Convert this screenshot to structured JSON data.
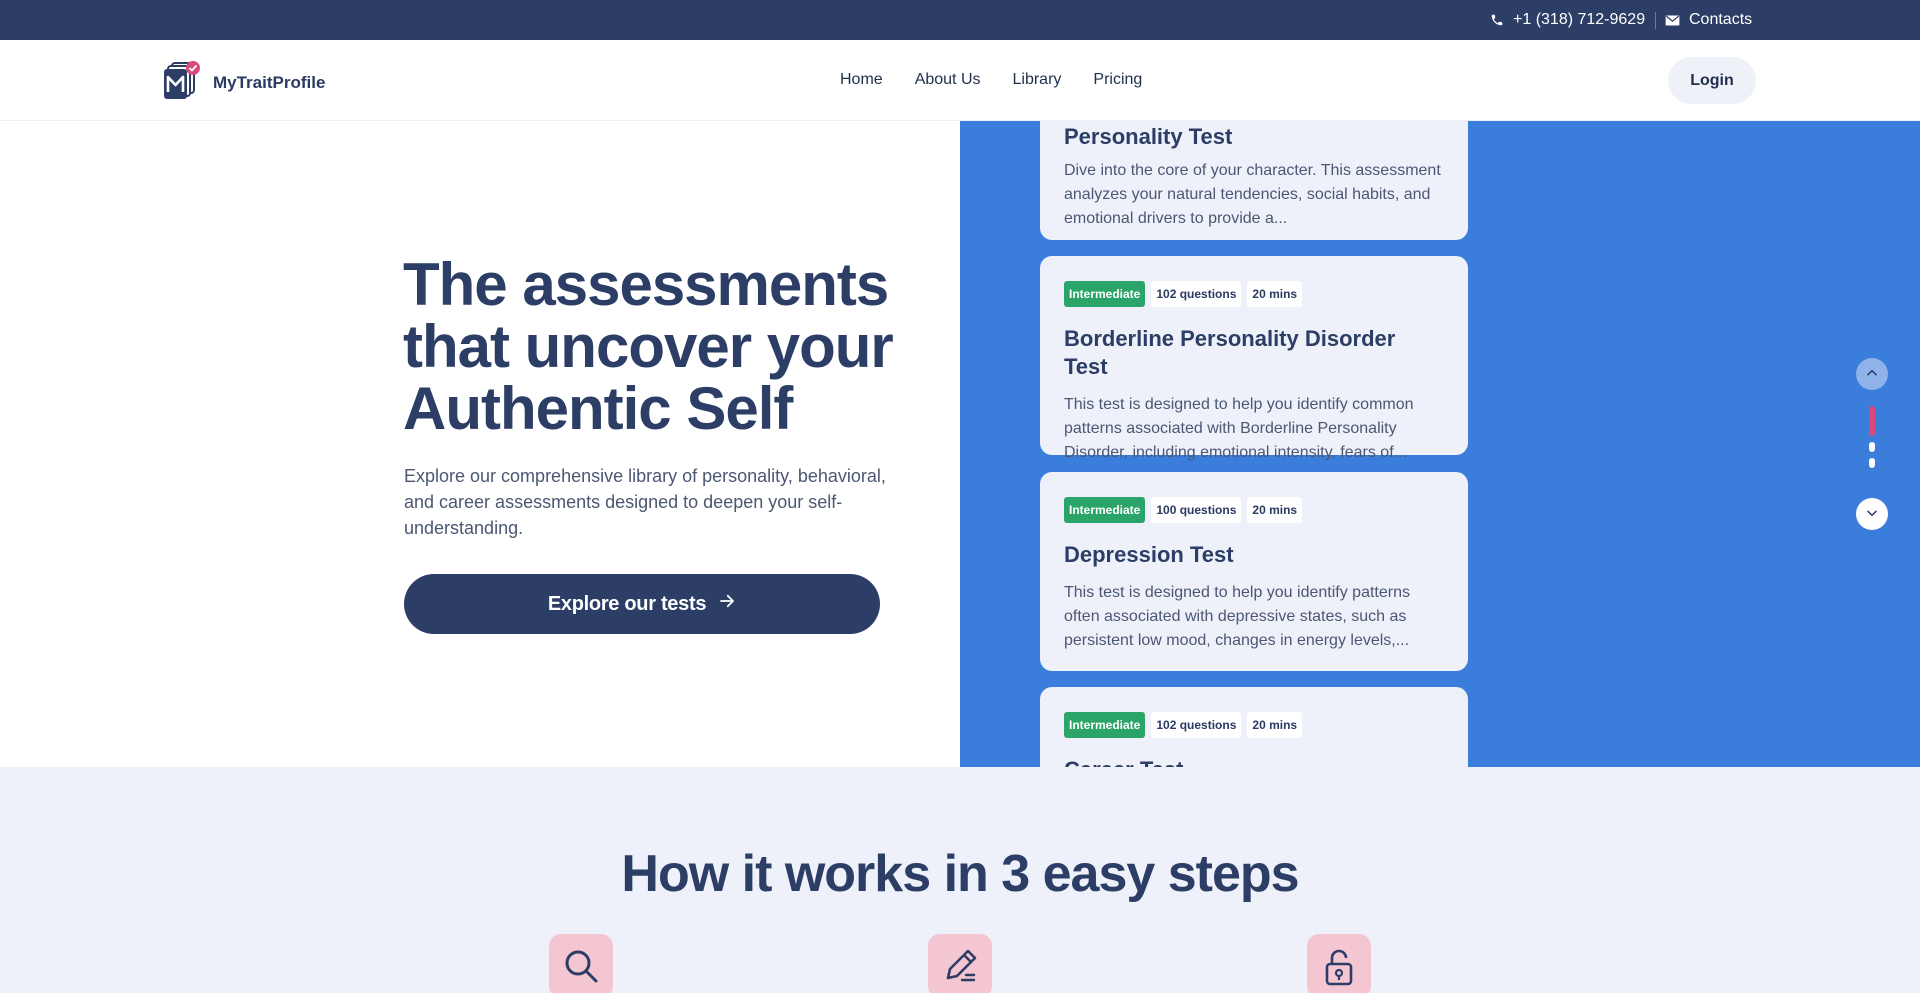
{
  "topbar": {
    "phone": "+1 (318) 712-9629",
    "contacts": "Contacts",
    "phone_icon": "phone-icon",
    "contacts_icon": "envelope-icon"
  },
  "header": {
    "brand": "MyTraitProfile",
    "nav": [
      "Home",
      "About Us",
      "Library",
      "Pricing"
    ],
    "login": "Login"
  },
  "hero": {
    "title_lines": [
      "The assessments",
      "that uncover your",
      "Authentic Self"
    ],
    "subtitle": "Explore our comprehensive library of personality, behavioral, and career assessments designed to deepen your self-understanding.",
    "cta": "Explore our tests"
  },
  "cards": [
    {
      "title": "Personality Test",
      "description": "Dive into the core of your character. This assessment analyzes your natural tendencies, social habits, and emotional drivers to provide a..."
    },
    {
      "level": "Intermediate",
      "questions": "102 questions",
      "duration": "20 mins",
      "title": "Borderline Personality Disorder Test",
      "description": "This test is designed to help you identify common patterns associated with Borderline Personality Disorder, including emotional intensity, fears of..."
    },
    {
      "level": "Intermediate",
      "questions": "100 questions",
      "duration": "20 mins",
      "title": "Depression Test",
      "description": "This test is designed to help you identify patterns often associated with depressive states, such as persistent low mood, changes in energy levels,..."
    },
    {
      "level": "Intermediate",
      "questions": "102 questions",
      "duration": "20 mins",
      "title": "Career Test",
      "description": ""
    }
  ],
  "steps": {
    "heading": "How it works in 3 easy steps",
    "icons": [
      "search-icon",
      "pencil-icon",
      "unlock-icon"
    ]
  },
  "colors": {
    "navy": "#2c3d66",
    "panel_blue": "#3b7ddb",
    "badge_green": "#2aa469",
    "accent_pink": "#d84a7b"
  }
}
